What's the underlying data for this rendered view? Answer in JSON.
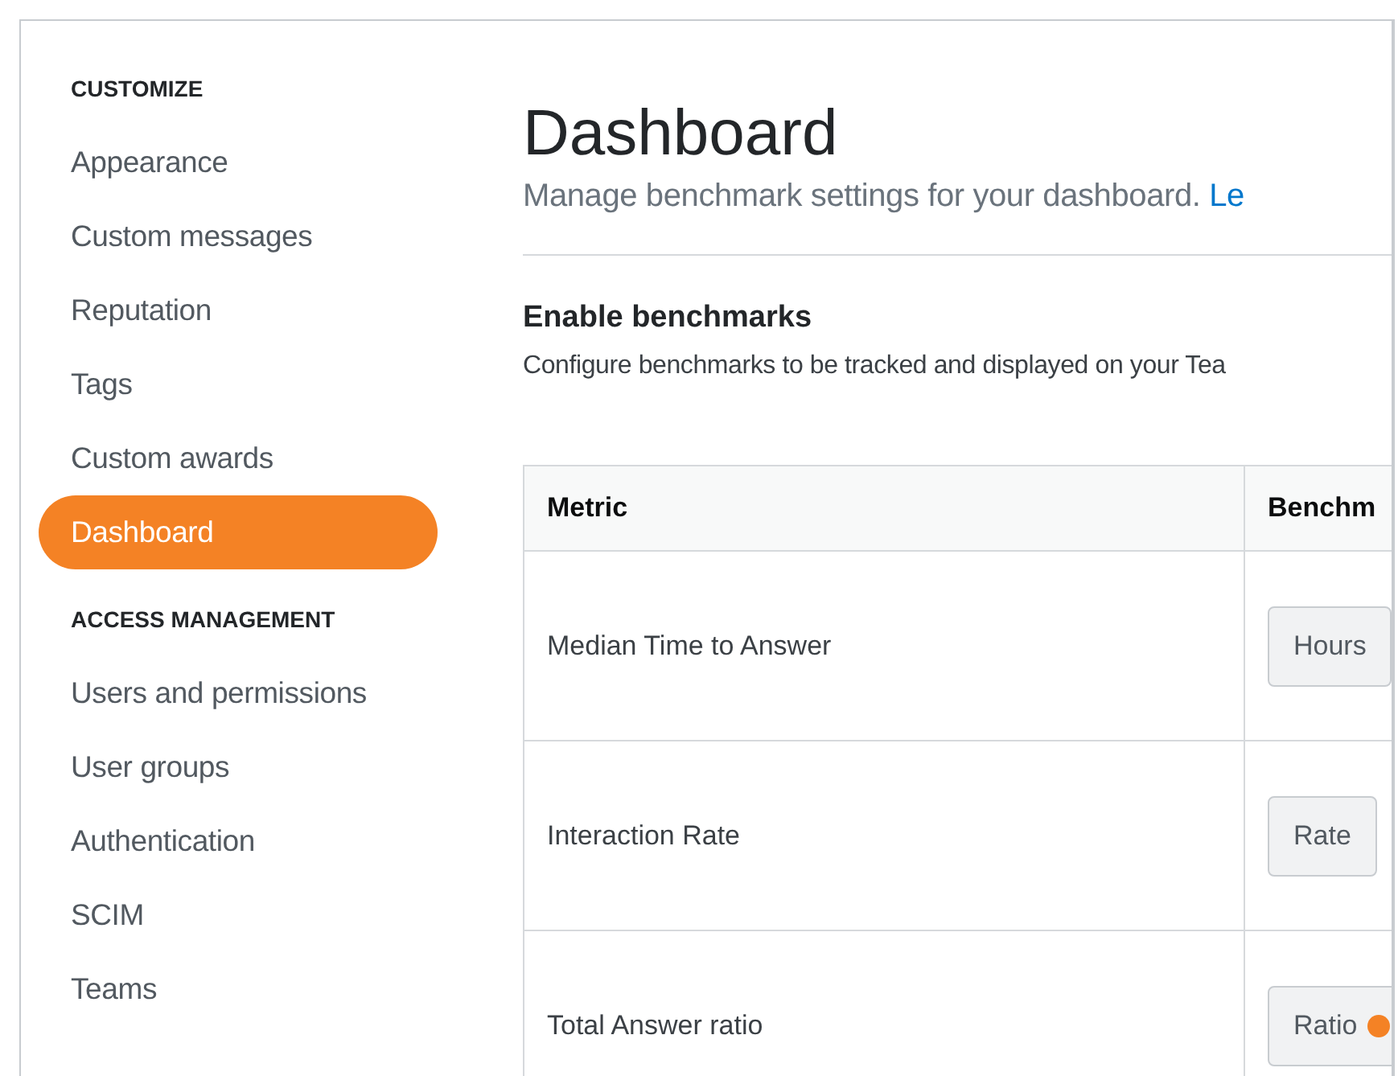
{
  "sidebar": {
    "sections": [
      {
        "heading": "CUSTOMIZE",
        "items": [
          {
            "label": "Appearance",
            "selected": false
          },
          {
            "label": "Custom messages",
            "selected": false
          },
          {
            "label": "Reputation",
            "selected": false
          },
          {
            "label": "Tags",
            "selected": false
          },
          {
            "label": "Custom awards",
            "selected": false
          },
          {
            "label": "Dashboard",
            "selected": true
          }
        ]
      },
      {
        "heading": "ACCESS MANAGEMENT",
        "items": [
          {
            "label": "Users and permissions",
            "selected": false
          },
          {
            "label": "User groups",
            "selected": false
          },
          {
            "label": "Authentication",
            "selected": false
          },
          {
            "label": "SCIM",
            "selected": false
          },
          {
            "label": "Teams",
            "selected": false
          }
        ]
      }
    ]
  },
  "page": {
    "title": "Dashboard",
    "subtitle": "Manage benchmark settings for your dashboard.",
    "subtitle_link": "Le"
  },
  "section": {
    "title": "Enable benchmarks",
    "description": "Configure benchmarks to be tracked and displayed on your Tea"
  },
  "table": {
    "columns": [
      "Metric",
      "Benchm"
    ],
    "rows": [
      {
        "metric": "Median Time to Answer",
        "unit": "Hours",
        "icon": false
      },
      {
        "metric": "Interaction Rate",
        "unit": "Rate",
        "icon": false
      },
      {
        "metric": "Total Answer ratio",
        "unit": "Ratio",
        "icon": true
      }
    ]
  }
}
